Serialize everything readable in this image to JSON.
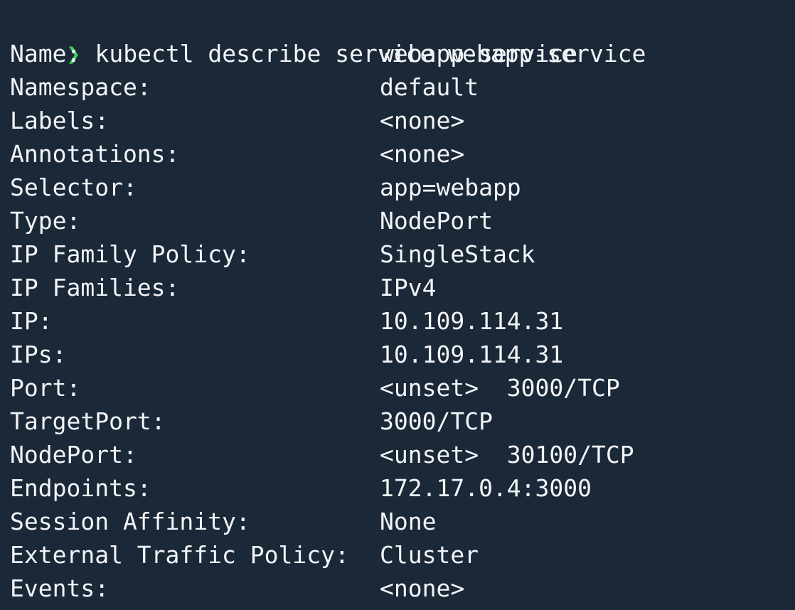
{
  "terminal": {
    "previous_line": "                                                        ",
    "prompt_symbol": "❯",
    "command": "kubectl describe service webapp-service",
    "rows": [
      {
        "key": "Name:",
        "value": "webapp-service"
      },
      {
        "key": "Namespace:",
        "value": "default"
      },
      {
        "key": "Labels:",
        "value": "<none>"
      },
      {
        "key": "Annotations:",
        "value": "<none>"
      },
      {
        "key": "Selector:",
        "value": "app=webapp"
      },
      {
        "key": "Type:",
        "value": "NodePort"
      },
      {
        "key": "IP Family Policy:",
        "value": "SingleStack"
      },
      {
        "key": "IP Families:",
        "value": "IPv4"
      },
      {
        "key": "IP:",
        "value": "10.109.114.31"
      },
      {
        "key": "IPs:",
        "value": "10.109.114.31"
      },
      {
        "key": "Port:",
        "value": "<unset>  3000/TCP"
      },
      {
        "key": "TargetPort:",
        "value": "3000/TCP"
      },
      {
        "key": "NodePort:",
        "value": "<unset>  30100/TCP"
      },
      {
        "key": "Endpoints:",
        "value": "172.17.0.4:3000"
      },
      {
        "key": "Session Affinity:",
        "value": "None"
      },
      {
        "key": "External Traffic Policy:",
        "value": "Cluster"
      },
      {
        "key": "Events:",
        "value": "<none>"
      }
    ]
  },
  "colors": {
    "background": "#1b2838",
    "text": "#f2f4f7",
    "prompt": "#3fcf5a"
  }
}
